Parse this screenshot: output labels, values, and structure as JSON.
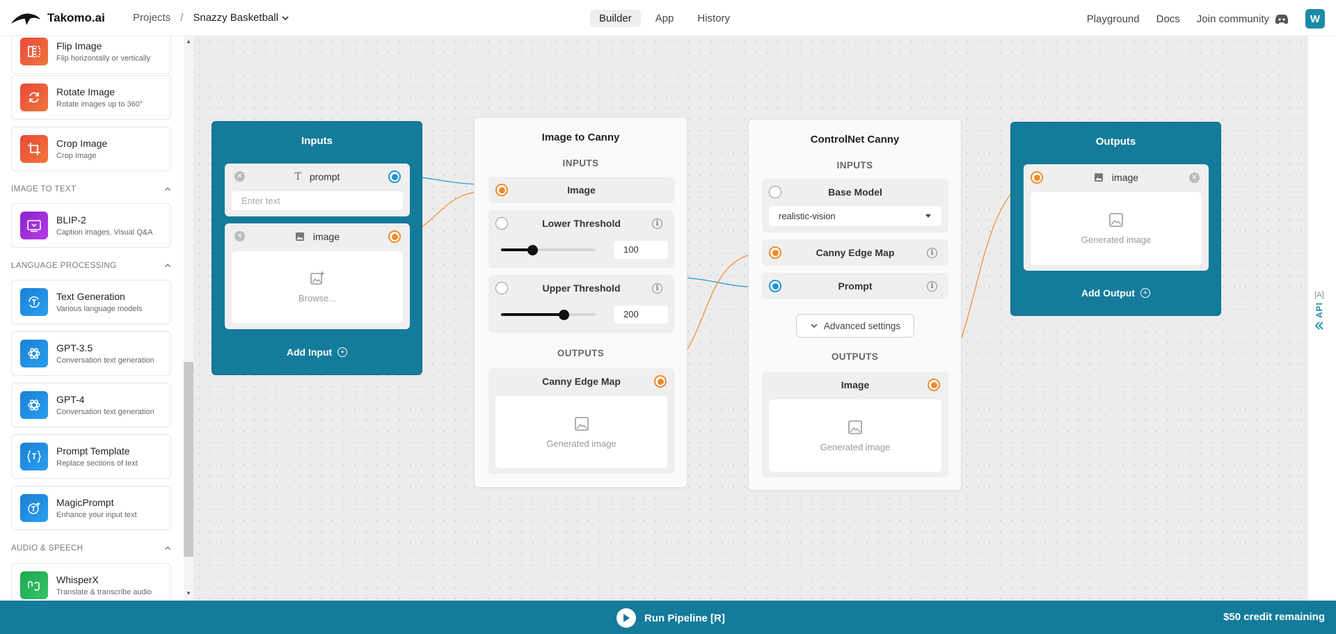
{
  "header": {
    "brand": "Takomo.ai",
    "breadcrumb": {
      "projects": "Projects",
      "separator": "/",
      "current": "Snazzy Basketball"
    },
    "tabs": [
      {
        "label": "Builder",
        "active": true
      },
      {
        "label": "App",
        "active": false
      },
      {
        "label": "History",
        "active": false
      }
    ],
    "nav": {
      "playground": "Playground",
      "docs": "Docs",
      "join": "Join community"
    },
    "avatar_initial": "W"
  },
  "sidebar": {
    "cards_top": [
      {
        "title": "Flip Image",
        "desc": "Flip horizontally or vertically",
        "icon": "flip-icon",
        "color": "#e0522f"
      },
      {
        "title": "Rotate Image",
        "desc": "Rotate images up to 360°",
        "icon": "rotate-icon",
        "color": "#e0522f"
      },
      {
        "title": "Crop Image",
        "desc": "Crop Image",
        "icon": "crop-icon",
        "color": "#e0522f"
      }
    ],
    "section_image_to_text": "IMAGE TO TEXT",
    "blip": {
      "title": "BLIP-2",
      "desc": "Caption images, Visual Q&A",
      "icon": "caption-icon",
      "color": "#9b2bd6"
    },
    "section_language": "LANGUAGE PROCESSING",
    "language_cards": [
      {
        "title": "Text Generation",
        "desc": "Various language models",
        "icon": "text-gen-icon",
        "color": "#1f8fe0"
      },
      {
        "title": "GPT-3.5",
        "desc": "Conversation text generation",
        "icon": "openai-icon",
        "color": "#1f8fe0"
      },
      {
        "title": "GPT-4",
        "desc": "Conversation text generation",
        "icon": "openai-icon",
        "color": "#1f8fe0"
      },
      {
        "title": "Prompt Template",
        "desc": "Replace sections of text",
        "icon": "template-icon",
        "color": "#1f8fe0"
      },
      {
        "title": "MagicPrompt",
        "desc": "Enhance your input text",
        "icon": "magic-icon",
        "color": "#1f8fe0"
      }
    ],
    "section_audio": "AUDIO & SPEECH",
    "whisper": {
      "title": "WhisperX",
      "desc": "Translate & transcribe audio",
      "icon": "audio-icon",
      "color": "#2bb55a"
    }
  },
  "inputs_node": {
    "title": "Inputs",
    "prompt_label": "prompt",
    "prompt_placeholder": "Enter text",
    "image_label": "image",
    "browse": "Browse...",
    "add_input": "Add Input"
  },
  "canny_node": {
    "title": "Image to Canny",
    "inputs_label": "INPUTS",
    "image_label": "Image",
    "lower_label": "Lower Threshold",
    "lower_value": "100",
    "lower_fraction": 0.33,
    "upper_label": "Upper Threshold",
    "upper_value": "200",
    "upper_fraction": 0.66,
    "outputs_label": "OUTPUTS",
    "output_label": "Canny Edge Map",
    "generated": "Generated image"
  },
  "controlnet_node": {
    "title": "ControlNet Canny",
    "inputs_label": "INPUTS",
    "base_model_label": "Base Model",
    "base_model_value": "realistic-vision",
    "canny_label": "Canny Edge Map",
    "prompt_label": "Prompt",
    "advanced": "Advanced settings",
    "outputs_label": "OUTPUTS",
    "output_label": "Image",
    "generated": "Generated image"
  },
  "outputs_node": {
    "title": "Outputs",
    "image_label": "image",
    "generated": "Generated image",
    "add_output": "Add Output"
  },
  "right_rail": {
    "shortcut": "[A]",
    "label": "API"
  },
  "footer": {
    "run_label": "Run Pipeline [R]",
    "credit": "$50 credit remaining"
  },
  "colors": {
    "teal": "#147b9b",
    "orange": "#f08a2c",
    "blue": "#1f93d6"
  }
}
